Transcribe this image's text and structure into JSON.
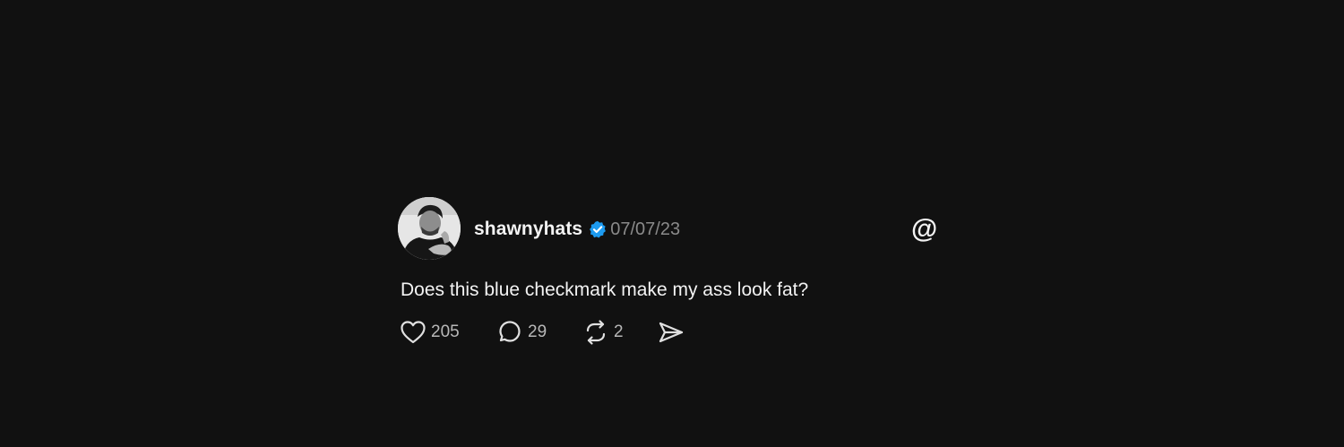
{
  "post": {
    "username": "shawnyhats",
    "verified": true,
    "timestamp": "07/07/23",
    "text": "Does this blue checkmark make my ass look fat?",
    "platform_icon": "threads-logo-icon",
    "avatar_icon": "user-avatar",
    "actions": {
      "like": {
        "icon": "heart-icon",
        "count": "205"
      },
      "reply": {
        "icon": "speech-bubble-icon",
        "count": "29"
      },
      "repost": {
        "icon": "repost-icon",
        "count": "2"
      },
      "share": {
        "icon": "send-icon"
      }
    }
  },
  "colors": {
    "background": "#111111",
    "text": "#f3f3f3",
    "muted": "#8a8a8a",
    "verified": "#1d9bf0"
  }
}
